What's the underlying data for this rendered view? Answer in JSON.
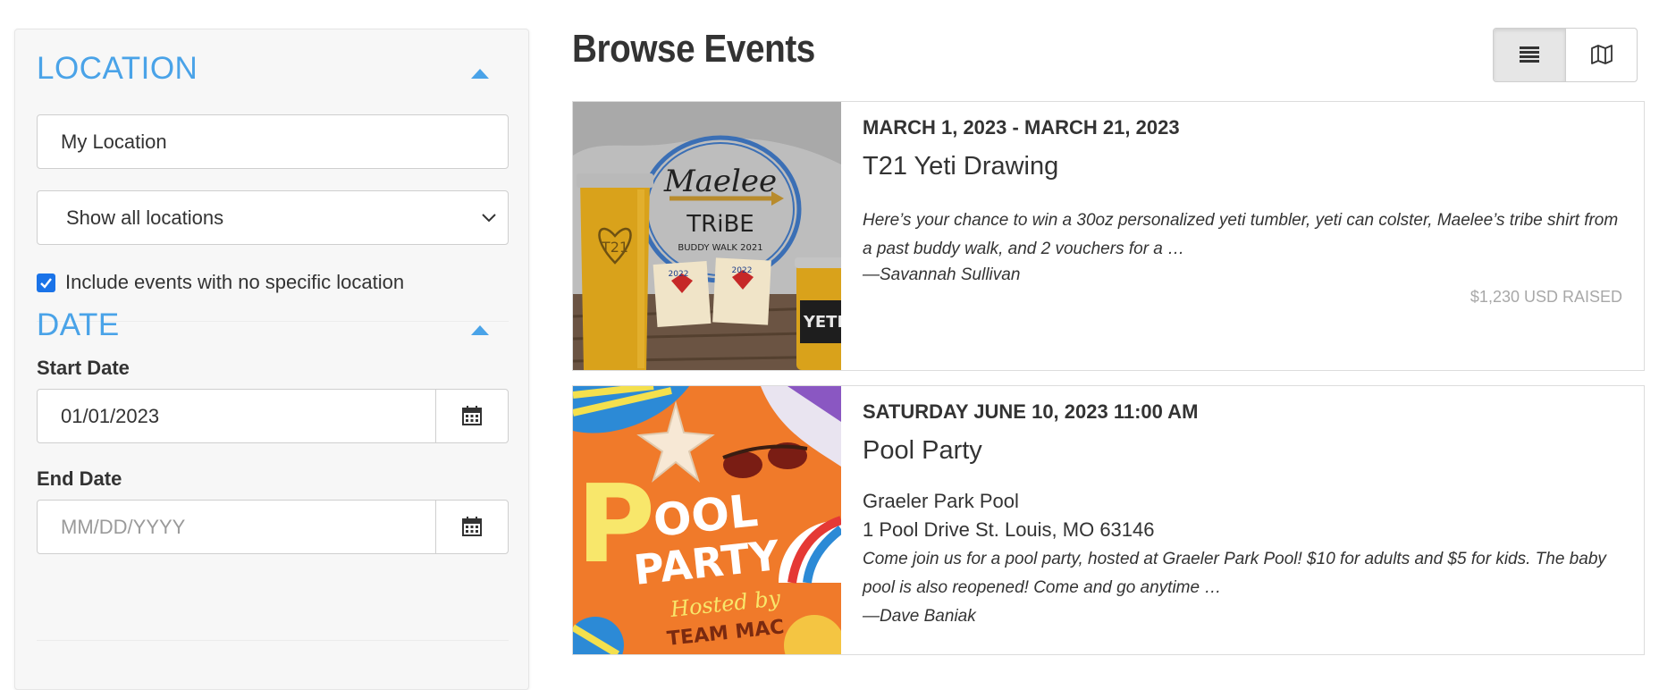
{
  "sidebar": {
    "location": {
      "title": "LOCATION",
      "location_value": "My Location",
      "select_value": "Show all locations",
      "checkbox_checked": true,
      "checkbox_label": "Include events with no specific location"
    },
    "date": {
      "title": "DATE",
      "start_label": "Start Date",
      "start_value": "01/01/2023",
      "end_label": "End Date",
      "end_placeholder": "MM/DD/YYYY"
    }
  },
  "main": {
    "title": "Browse Events",
    "view_toggle": {
      "active": "list",
      "icons": [
        "list-icon",
        "map-icon"
      ]
    },
    "events": [
      {
        "date": "MARCH 1, 2023 - MARCH 21, 2023",
        "title": "T21 Yeti Drawing",
        "description": "Here’s your chance to win a 30oz personalized yeti tumbler, yeti can colster, Maelee’s tribe shirt from a past buddy walk, and 2 vouchers for a …",
        "author": "—Savannah Sullivan",
        "raised": "$1,230 USD RAISED",
        "image_text": {
          "heart": "T21",
          "top": "Maelee",
          "middle": "TRiBE",
          "bottom": "BUDDY WALK 2021",
          "can": "YETI",
          "ticket": "2022"
        }
      },
      {
        "date": "SATURDAY JUNE 10, 2023 11:00 AM",
        "title": "Pool Party",
        "venue": "Graeler Park Pool",
        "address": "1 Pool Drive St. Louis, MO 63146",
        "description": "Come join us for a pool party, hosted at Graeler Park Pool!  $10 for adults and $5 for kids. The baby pool is also reopened!  Come and go anytime …",
        "author": "—Dave Baniak",
        "image_text": {
          "line1_big": "P",
          "line1_rest": "OOL",
          "line2": "PARTY",
          "hosted": "Hosted by",
          "team": "TEAM MAC"
        }
      }
    ]
  },
  "colors": {
    "accent": "#4aa3e8",
    "checkbox": "#1a73e8",
    "muted": "#a8a8a8"
  }
}
